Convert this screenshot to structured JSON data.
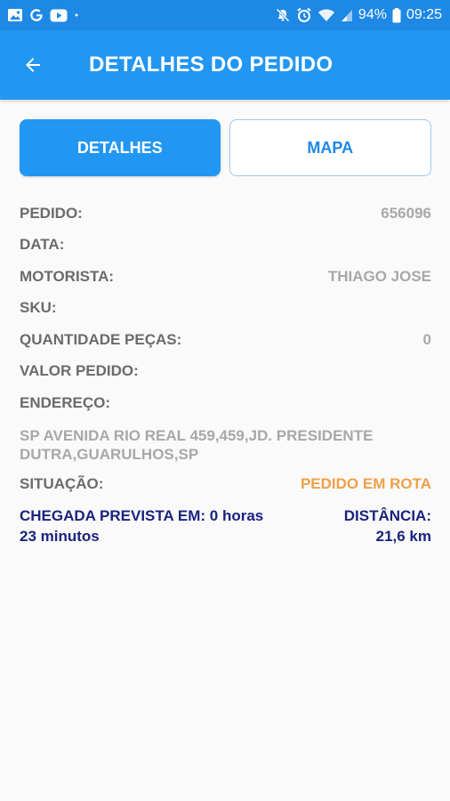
{
  "status_bar": {
    "battery": "94%",
    "time": "09:25"
  },
  "app_bar": {
    "title": "DETALHES DO PEDIDO"
  },
  "tabs": [
    {
      "label": "DETALHES"
    },
    {
      "label": "MAPA"
    }
  ],
  "details": {
    "pedido": {
      "label": "PEDIDO:",
      "value": "656096"
    },
    "data": {
      "label": "DATA:",
      "value": ""
    },
    "motorista": {
      "label": "MOTORISTA:",
      "value": "THIAGO JOSE"
    },
    "sku": {
      "label": "SKU:",
      "value": ""
    },
    "quantidade": {
      "label": "QUANTIDADE PEÇAS:",
      "value": "0"
    },
    "valor": {
      "label": "VALOR PEDIDO:",
      "value": ""
    },
    "endereco": {
      "label": "ENDEREÇO:",
      "value": "SP AVENIDA RIO REAL 459,459,JD. PRESIDENTE DUTRA,GUARULHOS,SP"
    },
    "situacao": {
      "label": "SITUAÇÃO:",
      "value": "PEDIDO EM ROTA"
    }
  },
  "eta": {
    "arrival_line1": "CHEGADA PREVISTA EM: 0 horas",
    "arrival_line2": "23 minutos",
    "distance_label": "DISTÂNCIA:",
    "distance_value": "21,6 km"
  },
  "colors": {
    "primary": "#2196f3",
    "status_bar": "#1e88e5",
    "status_pending": "#f0a04a",
    "eta_text": "#1a237e"
  },
  "icons": [
    "gallery-icon",
    "google-icon",
    "youtube-icon",
    "mute-icon",
    "alarm-icon",
    "wifi-icon",
    "signal-icon",
    "battery-icon",
    "arrow-back-icon"
  ]
}
